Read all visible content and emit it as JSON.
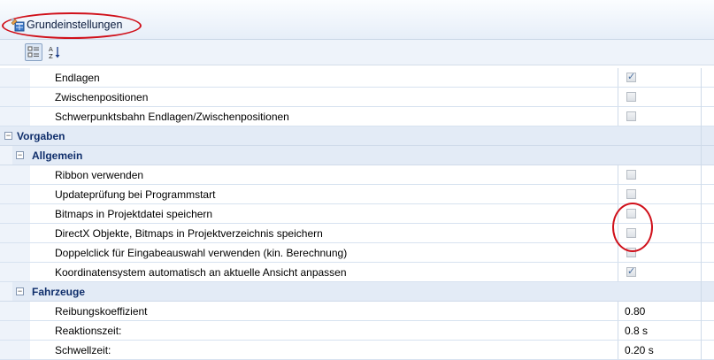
{
  "window": {
    "title": "Grundeinstellungen",
    "accent_color": "#d0101a"
  },
  "toolbar": {
    "categorized_icon": "categorized-view-icon",
    "sort_icon": "sort-az-icon"
  },
  "rows_top": [
    {
      "label": "Endlagen",
      "checked": true
    },
    {
      "label": "Zwischenpositionen",
      "checked": false
    },
    {
      "label": "Schwerpunktsbahn Endlagen/Zwischenpositionen",
      "checked": false
    }
  ],
  "cat_vorgaben": {
    "label": "Vorgaben",
    "toggle": "−"
  },
  "cat_allgemein": {
    "label": "Allgemein",
    "toggle": "−"
  },
  "rows_allgemein": [
    {
      "label": "Ribbon verwenden",
      "checked": false
    },
    {
      "label": "Updateprüfung bei Programmstart",
      "checked": false
    },
    {
      "label": "Bitmaps in Projektdatei speichern",
      "checked": false
    },
    {
      "label": "DirectX Objekte, Bitmaps in Projektverzeichnis speichern",
      "checked": false
    },
    {
      "label": "Doppelclick für Eingabeauswahl verwenden (kin. Berechnung)",
      "checked": false
    },
    {
      "label": "Koordinatensystem automatisch an aktuelle Ansicht anpassen",
      "checked": true
    }
  ],
  "cat_fahrzeuge": {
    "label": "Fahrzeuge",
    "toggle": "−"
  },
  "rows_fahrzeuge": [
    {
      "label": "Reibungskoeffizient",
      "value": "0.80"
    },
    {
      "label": "Reaktionszeit:",
      "value": "0.8 s"
    },
    {
      "label": "Schwellzeit:",
      "value": "0.20 s"
    }
  ]
}
